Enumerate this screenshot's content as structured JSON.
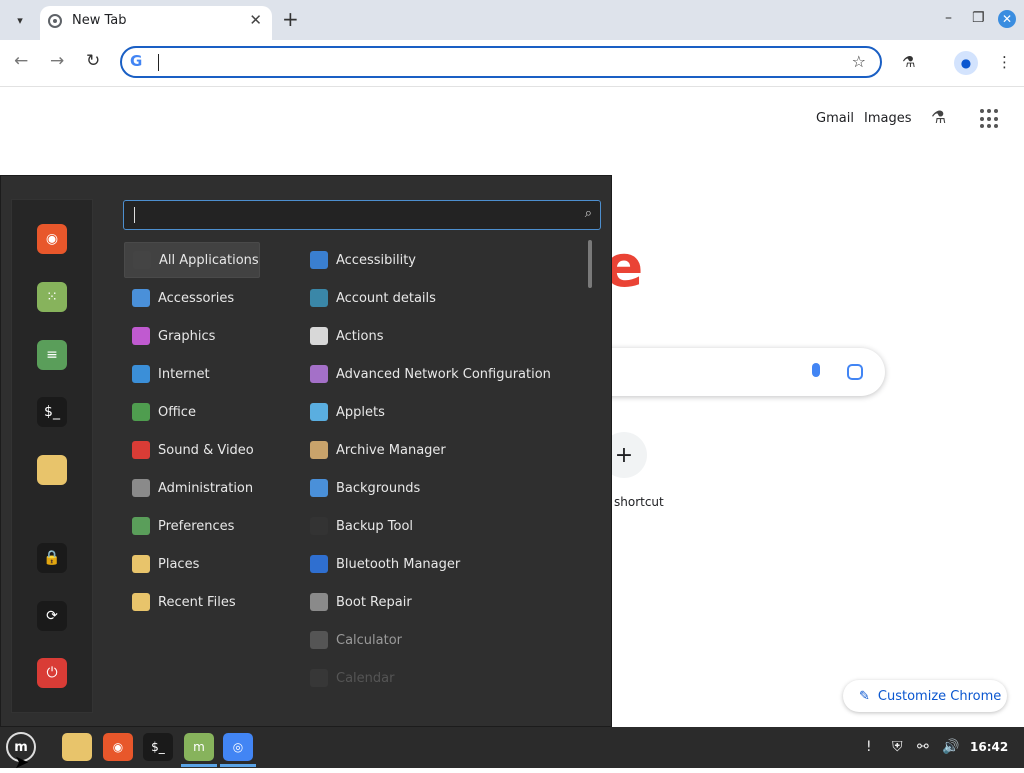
{
  "browser": {
    "tab_title": "New Tab",
    "toolbar": {},
    "ntp": {
      "gmail": "Gmail",
      "images": "Images",
      "logo_fragment": "e",
      "add_shortcut_label": "shortcut",
      "customize": "Customize Chrome"
    }
  },
  "menu": {
    "favorites": [
      {
        "name": "firefox",
        "icon": "firefox-icon",
        "color": "#e8572b"
      },
      {
        "name": "software-manager",
        "icon": "software-manager-icon",
        "color": "#87b35c"
      },
      {
        "name": "system-settings",
        "icon": "settings-icon",
        "color": "#5a9e5a"
      },
      {
        "name": "terminal",
        "icon": "terminal-icon",
        "color": "#1a1a1a"
      },
      {
        "name": "files",
        "icon": "folder-icon",
        "color": "#e8c46b"
      },
      {
        "name": "lock-screen",
        "icon": "lock-icon",
        "color": "#1a1a1a"
      },
      {
        "name": "logout",
        "icon": "logout-icon",
        "color": "#1a1a1a"
      },
      {
        "name": "shutdown",
        "icon": "power-icon",
        "color": "#d93c36"
      }
    ],
    "categories": [
      {
        "label": "All Applications",
        "icon": "grid-icon",
        "color": "#444444"
      },
      {
        "label": "Accessories",
        "icon": "scissors-icon",
        "color": "#4a90d9"
      },
      {
        "label": "Graphics",
        "icon": "graphics-icon",
        "color": "#c05ad0"
      },
      {
        "label": "Internet",
        "icon": "cloud-icon",
        "color": "#3b8fd8"
      },
      {
        "label": "Office",
        "icon": "office-icon",
        "color": "#4f9d4f"
      },
      {
        "label": "Sound & Video",
        "icon": "play-icon",
        "color": "#d93c36"
      },
      {
        "label": "Administration",
        "icon": "admin-icon",
        "color": "#8a8a8a"
      },
      {
        "label": "Preferences",
        "icon": "preferences-icon",
        "color": "#5a9e5a"
      },
      {
        "label": "Places",
        "icon": "folder-icon",
        "color": "#e8c46b"
      },
      {
        "label": "Recent Files",
        "icon": "recent-folder-icon",
        "color": "#e8c46b"
      }
    ],
    "apps": [
      {
        "label": "Accessibility",
        "icon": "accessibility-icon",
        "color": "#3a7fd0",
        "state": "normal"
      },
      {
        "label": "Account details",
        "icon": "account-icon",
        "color": "#3a87a8",
        "state": "normal"
      },
      {
        "label": "Actions",
        "icon": "actions-icon",
        "color": "#d8d8d8",
        "state": "normal"
      },
      {
        "label": "Advanced Network Configuration",
        "icon": "network-config-icon",
        "color": "#a470c8",
        "state": "normal"
      },
      {
        "label": "Applets",
        "icon": "applets-icon",
        "color": "#5aaee0",
        "state": "normal"
      },
      {
        "label": "Archive Manager",
        "icon": "archive-icon",
        "color": "#c9a36b",
        "state": "normal"
      },
      {
        "label": "Backgrounds",
        "icon": "backgrounds-icon",
        "color": "#4a90d9",
        "state": "normal"
      },
      {
        "label": "Backup Tool",
        "icon": "backup-icon",
        "color": "#333333",
        "state": "normal"
      },
      {
        "label": "Bluetooth Manager",
        "icon": "bluetooth-icon",
        "color": "#2f6fd0",
        "state": "normal"
      },
      {
        "label": "Boot Repair",
        "icon": "boot-repair-icon",
        "color": "#8a8a8a",
        "state": "normal"
      },
      {
        "label": "Calculator",
        "icon": "calculator-icon",
        "color": "#555555",
        "state": "dim"
      },
      {
        "label": "Calendar",
        "icon": "calendar-icon",
        "color": "#444444",
        "state": "faint"
      }
    ]
  },
  "taskbar": {
    "apps": [
      {
        "name": "files",
        "icon": "folder-icon",
        "color": "#e8c46b",
        "active": false
      },
      {
        "name": "firefox",
        "icon": "firefox-icon",
        "color": "#e8572b",
        "active": false
      },
      {
        "name": "terminal",
        "icon": "terminal-icon",
        "color": "#1a1a1a",
        "active": false
      },
      {
        "name": "software-manager",
        "icon": "mint-icon",
        "color": "#87b35c",
        "active": true
      },
      {
        "name": "chrome",
        "icon": "chrome-icon",
        "color": "#4285f4",
        "active": true
      }
    ],
    "clock": "16:42"
  }
}
